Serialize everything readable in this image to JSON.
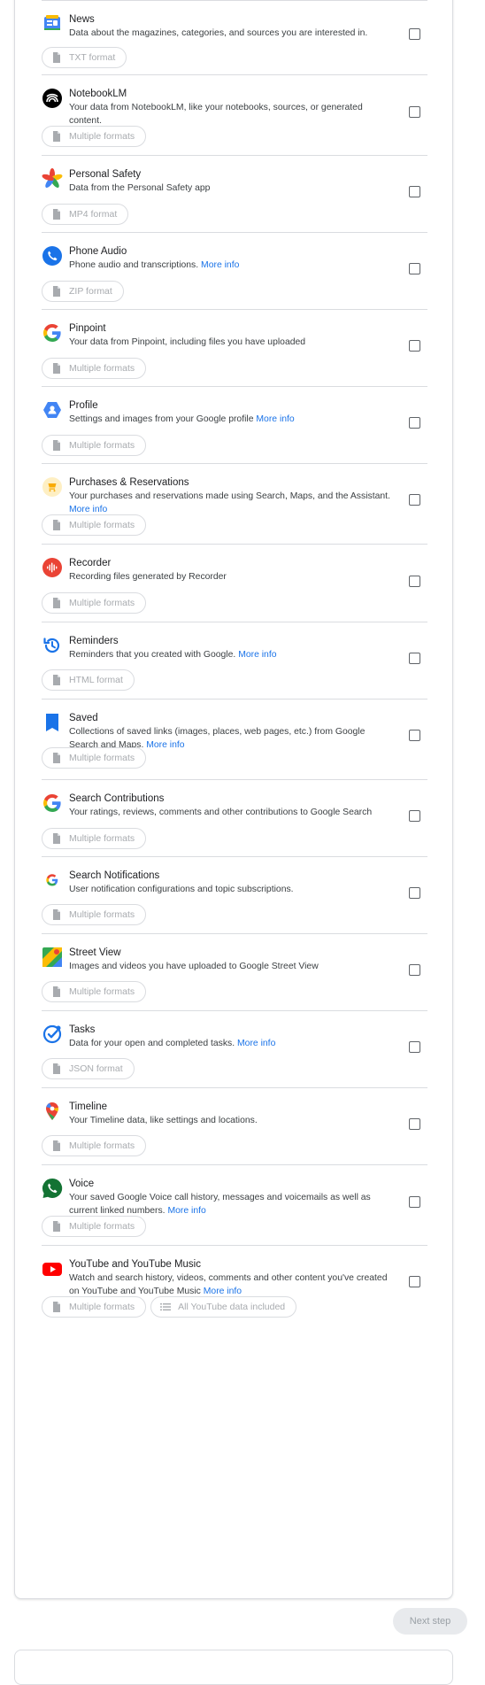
{
  "services": [
    {
      "key": "news",
      "name": "News",
      "desc": "Data about the magazines, categories, and sources you are interested in.",
      "more": "",
      "formats": [
        "TXT format"
      ],
      "icon": "google-news-icon"
    },
    {
      "key": "notebooklm",
      "name": "NotebookLM",
      "desc": "Your data from NotebookLM, like your notebooks, sources, or generated content.",
      "more": "",
      "formats": [
        "Multiple formats"
      ],
      "icon": "notebooklm-icon"
    },
    {
      "key": "personal-safety",
      "name": "Personal Safety",
      "desc": "Data from the Personal Safety app",
      "more": "",
      "formats": [
        "MP4 format"
      ],
      "icon": "personal-safety-icon"
    },
    {
      "key": "phone-audio",
      "name": "Phone Audio",
      "desc": "Phone audio and transcriptions.",
      "more": "More info",
      "formats": [
        "ZIP format"
      ],
      "icon": "phone-icon"
    },
    {
      "key": "pinpoint",
      "name": "Pinpoint",
      "desc": "Your data from Pinpoint, including files you have uploaded",
      "more": "",
      "formats": [
        "Multiple formats"
      ],
      "icon": "google-g-icon"
    },
    {
      "key": "profile",
      "name": "Profile",
      "desc": "Settings and images from your Google profile",
      "more": "More info",
      "formats": [
        "Multiple formats"
      ],
      "icon": "profile-icon"
    },
    {
      "key": "purchases",
      "name": "Purchases & Reservations",
      "desc": "Your purchases and reservations made using Search, Maps, and the Assistant.",
      "more": "More info",
      "formats": [
        "Multiple formats"
      ],
      "icon": "cart-icon"
    },
    {
      "key": "recorder",
      "name": "Recorder",
      "desc": "Recording files generated by Recorder",
      "more": "",
      "formats": [
        "Multiple formats"
      ],
      "icon": "recorder-icon"
    },
    {
      "key": "reminders",
      "name": "Reminders",
      "desc": "Reminders that you created with Google.",
      "more": "More info",
      "formats": [
        "HTML format"
      ],
      "icon": "reminders-icon"
    },
    {
      "key": "saved",
      "name": "Saved",
      "desc": "Collections of saved links (images, places, web pages, etc.) from Google Search and Maps.",
      "more": "More info",
      "formats": [
        "Multiple formats"
      ],
      "icon": "bookmark-icon"
    },
    {
      "key": "search-contributions",
      "name": "Search Contributions",
      "desc": "Your ratings, reviews, comments and other contributions to Google Search",
      "more": "",
      "formats": [
        "Multiple formats"
      ],
      "icon": "google-g-icon"
    },
    {
      "key": "search-notifications",
      "name": "Search Notifications",
      "desc": "User notification configurations and topic subscriptions.",
      "more": "",
      "formats": [
        "Multiple formats"
      ],
      "icon": "google-g-small-icon"
    },
    {
      "key": "street-view",
      "name": "Street View",
      "desc": "Images and videos you have uploaded to Google Street View",
      "more": "",
      "formats": [
        "Multiple formats"
      ],
      "icon": "street-view-icon"
    },
    {
      "key": "tasks",
      "name": "Tasks",
      "desc": "Data for your open and completed tasks.",
      "more": "More info",
      "formats": [
        "JSON format"
      ],
      "icon": "tasks-icon"
    },
    {
      "key": "timeline",
      "name": "Timeline",
      "desc": "Your Timeline data, like settings and locations.",
      "more": "",
      "formats": [
        "Multiple formats"
      ],
      "icon": "maps-pin-icon"
    },
    {
      "key": "voice",
      "name": "Voice",
      "desc": "Your saved Google Voice call history, messages and voicemails as well as current linked numbers.",
      "more": "More info",
      "formats": [
        "Multiple formats"
      ],
      "icon": "google-voice-icon"
    },
    {
      "key": "youtube",
      "name": "YouTube and YouTube Music",
      "desc": "Watch and search history, videos, comments and other content you've created on YouTube and YouTube Music",
      "more": "More info",
      "formats": [
        "Multiple formats",
        "All YouTube data included"
      ],
      "icon": "youtube-icon"
    }
  ],
  "footer": {
    "next_label": "Next step"
  },
  "colors": {
    "link": "#1a73e8",
    "divider": "#dadce0",
    "chip_text": "#a8abaf"
  }
}
